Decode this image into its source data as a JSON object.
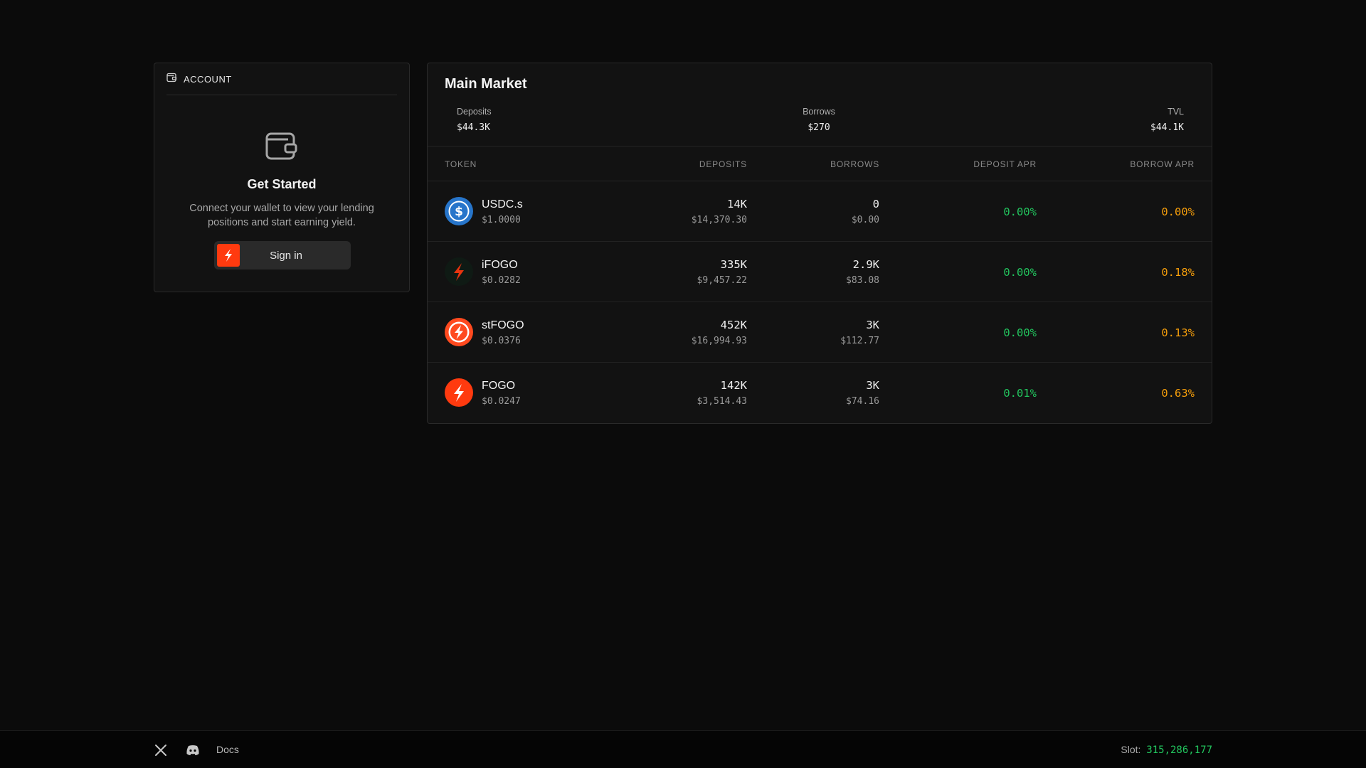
{
  "account": {
    "header_label": "ACCOUNT",
    "title": "Get Started",
    "description": "Connect your wallet to view your lending positions and start earning yield.",
    "signin_label": "Sign in"
  },
  "market": {
    "title": "Main Market",
    "stats": {
      "deposits_label": "Deposits",
      "deposits_value": "$44.3K",
      "borrows_label": "Borrows",
      "borrows_value": "$270",
      "tvl_label": "TVL",
      "tvl_value": "$44.1K"
    },
    "columns": {
      "token": "TOKEN",
      "deposits": "DEPOSITS",
      "borrows": "BORROWS",
      "deposit_apr": "DEPOSIT APR",
      "borrow_apr": "BORROW APR"
    },
    "rows": [
      {
        "name": "USDC.s",
        "price": "$1.0000",
        "deposits": "14K",
        "deposits_usd": "$14,370.30",
        "borrows": "0",
        "borrows_usd": "$0.00",
        "deposit_apr": "0.00%",
        "borrow_apr": "0.00%",
        "icon": "usdc-icon"
      },
      {
        "name": "iFOGO",
        "price": "$0.0282",
        "deposits": "335K",
        "deposits_usd": "$9,457.22",
        "borrows": "2.9K",
        "borrows_usd": "$83.08",
        "deposit_apr": "0.00%",
        "borrow_apr": "0.18%",
        "icon": "ifogo-icon"
      },
      {
        "name": "stFOGO",
        "price": "$0.0376",
        "deposits": "452K",
        "deposits_usd": "$16,994.93",
        "borrows": "3K",
        "borrows_usd": "$112.77",
        "deposit_apr": "0.00%",
        "borrow_apr": "0.13%",
        "icon": "stfogo-icon"
      },
      {
        "name": "FOGO",
        "price": "$0.0247",
        "deposits": "142K",
        "deposits_usd": "$3,514.43",
        "borrows": "3K",
        "borrows_usd": "$74.16",
        "deposit_apr": "0.01%",
        "borrow_apr": "0.63%",
        "icon": "fogo-icon"
      }
    ]
  },
  "footer": {
    "docs_label": "Docs",
    "slot_label": "Slot:",
    "slot_value": "315,286,177"
  },
  "colors": {
    "accent_orange": "#ff3a0f",
    "positive_green": "#22c55e",
    "borrow_apr_amber": "#f59e0b",
    "usdc_blue": "#2775ca"
  }
}
